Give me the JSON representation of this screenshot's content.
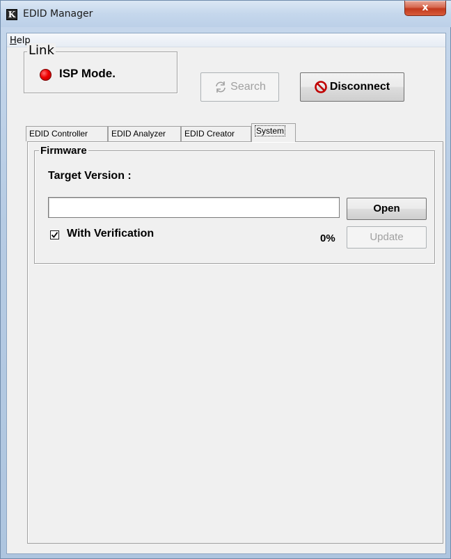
{
  "window": {
    "title": "EDID Manager",
    "app_icon_letter": "K",
    "close_glyph": "x"
  },
  "menu": {
    "help": "Help",
    "help_mnemonic": "H",
    "help_rest": "elp"
  },
  "link": {
    "legend": "Link",
    "status": "ISP Mode.",
    "status_color": "#ee0000"
  },
  "toolbar": {
    "search_label": "Search",
    "search_icon": "refresh-icon",
    "disconnect_label": "Disconnect",
    "disconnect_icon": "no-entry-icon"
  },
  "tabs": [
    {
      "label": "EDID Controller",
      "selected": false
    },
    {
      "label": "EDID Analyzer",
      "selected": false
    },
    {
      "label": "EDID Creator",
      "selected": false
    },
    {
      "label": "System",
      "selected": true
    }
  ],
  "firmware": {
    "legend": "Firmware",
    "target_label": "Target Version :",
    "path_value": "",
    "open_label": "Open",
    "verification_label": "With Verification",
    "verification_checked": true,
    "progress_text": "0%",
    "progress": 0,
    "update_label": "Update"
  }
}
